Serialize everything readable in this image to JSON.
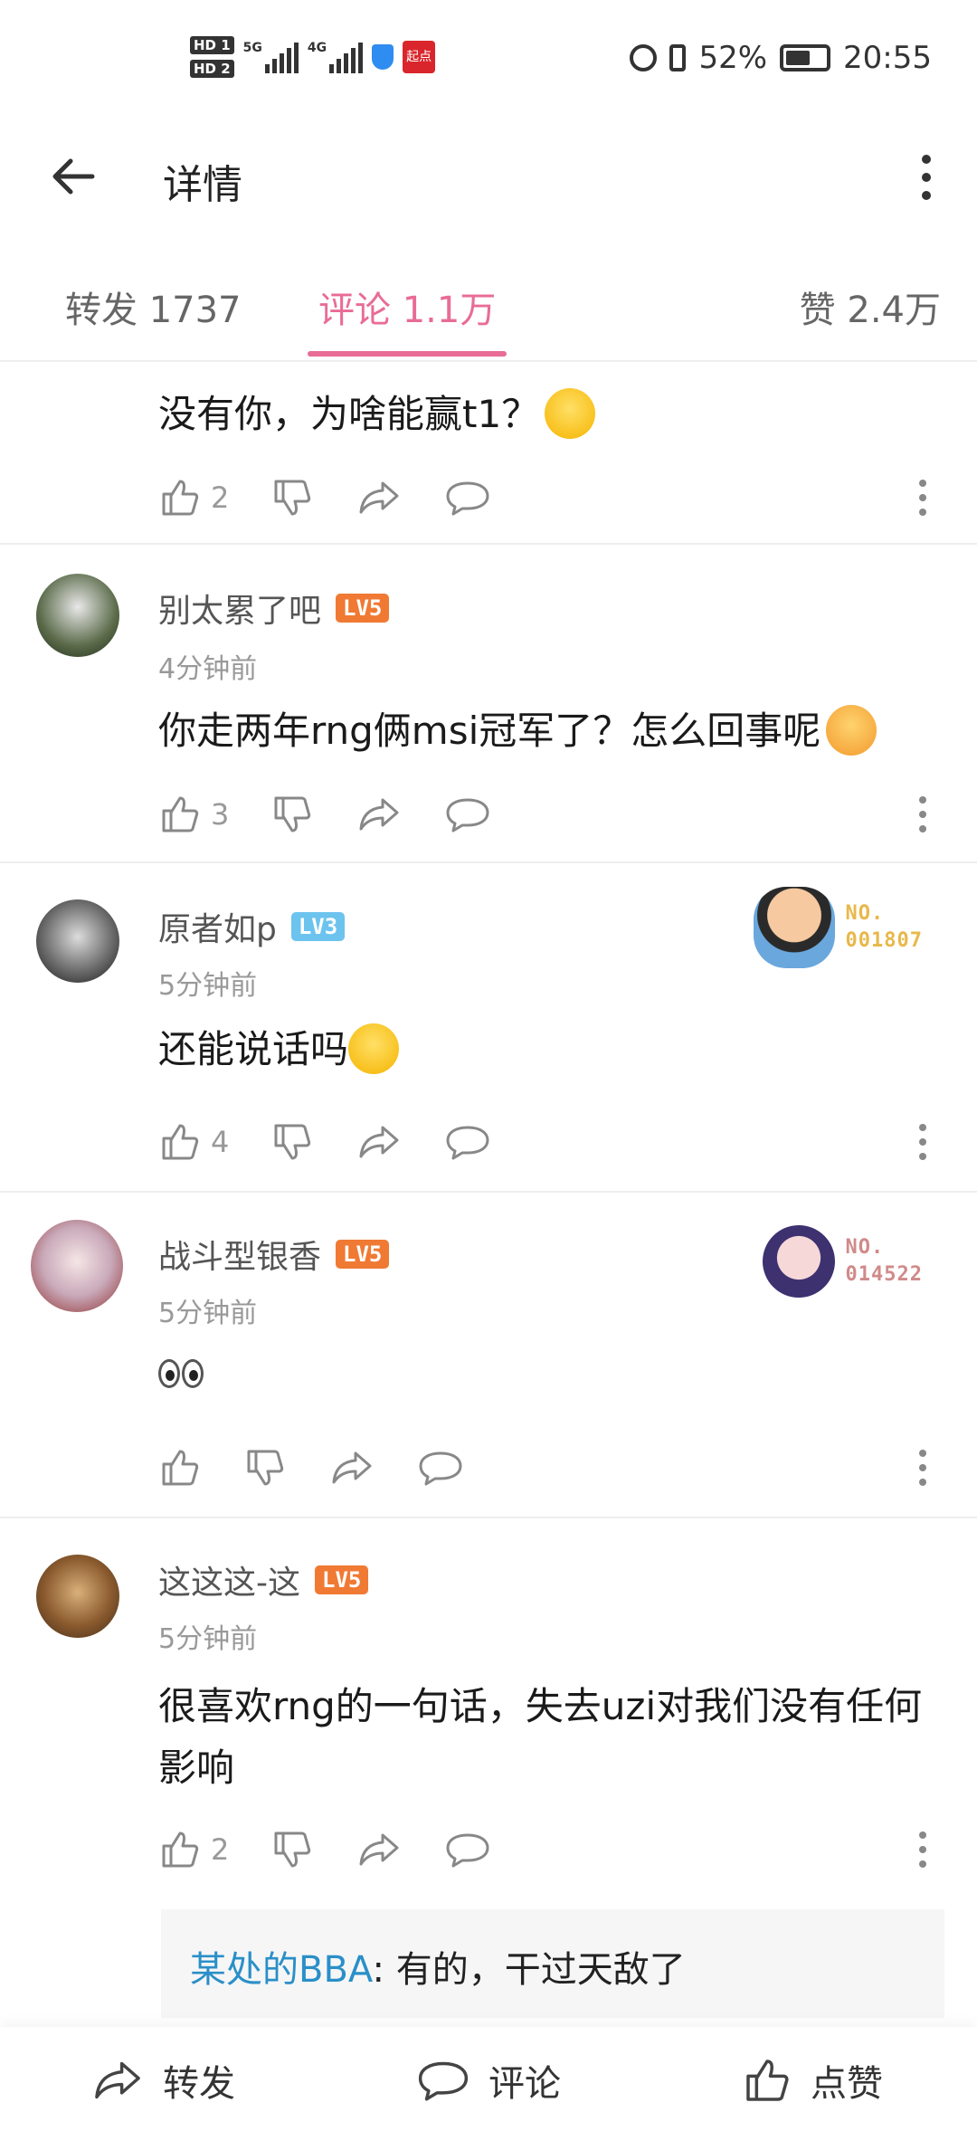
{
  "status_bar": {
    "hd1": "HD 1",
    "hd2": "HD 2",
    "net1": "5G",
    "net2": "4G",
    "app_badge": "起点",
    "battery": "52%",
    "time": "20:55"
  },
  "header": {
    "title": "详情"
  },
  "tabs": [
    {
      "label": "转发 1737"
    },
    {
      "label": "评论 1.1万"
    },
    {
      "label": "赞 2.4万"
    }
  ],
  "comments": [
    {
      "text": "没有你，为啥能赢t1？",
      "likes": "2"
    },
    {
      "user": "别太累了吧",
      "level": "LV5",
      "time": "4分钟前",
      "text": "你走两年rng俩msi冠军了？怎么回事呢",
      "likes": "3"
    },
    {
      "user": "原者如p",
      "level": "LV3",
      "time": "5分钟前",
      "text": "还能说话吗",
      "likes": "4",
      "fan_no": "NO.",
      "fan_num": "001807"
    },
    {
      "user": "战斗型银香",
      "level": "LV5",
      "time": "5分钟前",
      "text": "",
      "likes": "",
      "fan_no": "NO.",
      "fan_num": "014522"
    },
    {
      "user": "这这这-这",
      "level": "LV5",
      "time": "5分钟前",
      "text": "很喜欢rng的一句话，失去uzi对我们没有任何影响",
      "likes": "2"
    }
  ],
  "reply": {
    "user": "某处的BBA",
    "text": ": 有的，干过天敌了"
  },
  "bottom_bar": {
    "repost": "转发",
    "comment": "评论",
    "like": "点赞"
  },
  "colors": {
    "accent": "#e86c96",
    "lv5": "#f07a34",
    "lv3": "#6cc3ee",
    "link": "#2a8fc8"
  }
}
